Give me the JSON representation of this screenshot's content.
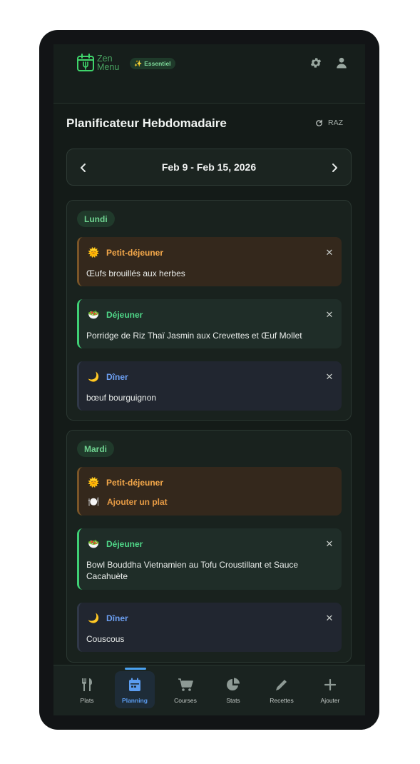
{
  "header": {
    "logo_line1": "Zen",
    "logo_line2": "Menu",
    "badge_label": "Essentiel",
    "badge_icon": "sparkle-icon",
    "settings_icon": "gear-icon",
    "profile_icon": "user-icon"
  },
  "page": {
    "title": "Planificateur Hebdomadaire",
    "reset_label": "RAZ"
  },
  "week": {
    "label": "Feb 9 - Feb 15, 2026"
  },
  "days": [
    {
      "name": "Lundi",
      "meals": [
        {
          "type": "Petit-déjeuner",
          "icon": "sun-icon",
          "dish": "Œufs brouillés aux herbes"
        },
        {
          "type": "Déjeuner",
          "icon": "salad-bowl-icon",
          "dish": "Porridge de Riz Thaï Jasmin aux Crevettes et Œuf Mollet"
        },
        {
          "type": "Dîner",
          "icon": "moon-icon",
          "dish": "bœuf bourguignon"
        }
      ]
    },
    {
      "name": "Mardi",
      "meals": [
        {
          "type": "Petit-déjeuner",
          "icon": "sun-icon",
          "add_label": "Ajouter un plat"
        },
        {
          "type": "Déjeuner",
          "icon": "salad-bowl-icon",
          "dish_line1": "Bowl Bouddha Vietnamien au Tofu Croustillant et Sauce",
          "dish_line2": "Cacahuète"
        },
        {
          "type": "Dîner",
          "icon": "moon-icon",
          "dish": "Couscous"
        }
      ]
    }
  ],
  "nav": [
    {
      "label": "Plats",
      "icon": "utensils-icon"
    },
    {
      "label": "Planning",
      "icon": "calendar-icon",
      "active": true
    },
    {
      "label": "Courses",
      "icon": "cart-icon"
    },
    {
      "label": "Stats",
      "icon": "pie-chart-icon"
    },
    {
      "label": "Recettes",
      "icon": "pencil-icon"
    },
    {
      "label": "Ajouter",
      "icon": "plus-icon"
    }
  ],
  "colors": {
    "accent_green": "#3fcf75",
    "breakfast": "#f4a84a",
    "dinner": "#6c9ff2",
    "active_nav": "#5b9cf0"
  }
}
